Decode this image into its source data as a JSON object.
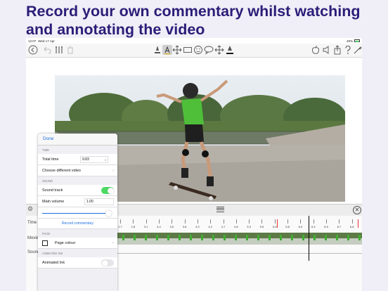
{
  "headline": {
    "line1": "Record your own commentary whilst watching",
    "line2": "and annotating the video"
  },
  "status_bar": {
    "time": "12:07",
    "date": "Wed 17 Apr",
    "battery": "49%"
  },
  "toolbar": {
    "left_icons": [
      "back-circle-icon",
      "undo-icon",
      "tools-icon",
      "trash-icon"
    ],
    "center_icons": [
      "pen-icon",
      "text-icon",
      "move-arrows-icon",
      "rectangle-icon",
      "smiley-icon",
      "speech-bubble-icon",
      "move-arrows-icon",
      "highlighter-icon"
    ],
    "right_icons": [
      "apple-icon",
      "speaker-icon",
      "share-icon",
      "help-icon",
      "brush-icon"
    ]
  },
  "tracks": {
    "time_label": "Time",
    "movie_label": "Movie",
    "sound_label": "Sound",
    "ticks": [
      "2.7",
      "2.8",
      "2.9",
      "3.0",
      "3.1",
      "3.2",
      "3.3",
      "3.4",
      "3.5",
      "3.6",
      "3.7",
      "3.8",
      "3.9",
      "4.0",
      "4.1",
      "4.2"
    ],
    "tick_labels": [
      "2.7",
      "2.8",
      "3.1",
      "3.4",
      "3.6",
      "3.8",
      "4.0",
      "4.2",
      "4.7",
      "4.8",
      "5.3",
      "5.5",
      "5.6",
      "5.8",
      "6.0",
      "6.3",
      "6.5",
      "6.7",
      "6.8"
    ]
  },
  "settings_panel": {
    "done_label": "Done",
    "time_section": "TIME",
    "total_time_label": "Total time",
    "total_time_value": "9.83",
    "choose_video_label": "Choose different video",
    "sound_section": "SOUND",
    "sound_track_label": "Sound track",
    "sound_track_on": true,
    "main_volume_label": "Main volume",
    "main_volume_value": "1.00",
    "main_volume_level": 1.0,
    "record_commentary_label": "Record commentary",
    "page_section": "PAGE",
    "page_colour_label": "Page colour",
    "animated_ink_section": "ANIMATED INK",
    "animated_ink_label": "Animated Ink",
    "animated_ink_on": false
  },
  "colors": {
    "headline": "#2b1d78",
    "accent": "#1d6fe0",
    "toggle_on": "#4cd964"
  }
}
